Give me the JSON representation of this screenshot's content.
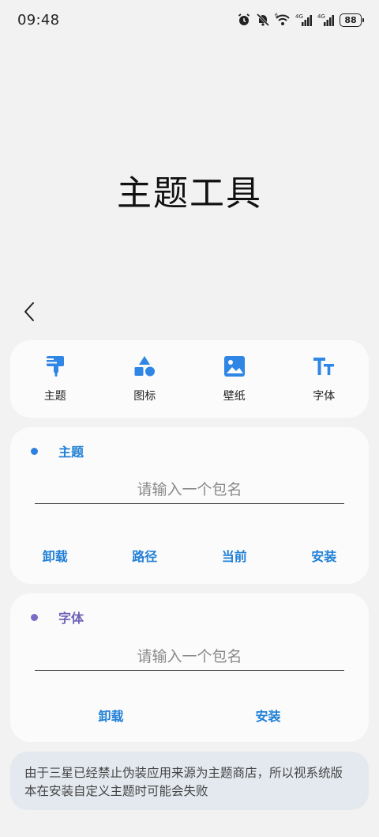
{
  "status_bar": {
    "time": "09:48",
    "icons": [
      "alarm-icon",
      "mute-icon",
      "wifi-icon",
      "signal-4g-icon",
      "signal-4g-icon"
    ],
    "battery": "88"
  },
  "header": {
    "title": "主题工具"
  },
  "tabs": [
    {
      "label": "主题",
      "icon": "brush-icon"
    },
    {
      "label": "图标",
      "icon": "shapes-icon"
    },
    {
      "label": "壁纸",
      "icon": "image-icon"
    },
    {
      "label": "字体",
      "icon": "font-icon"
    }
  ],
  "theme_section": {
    "title": "主题",
    "placeholder": "请输入一个包名",
    "actions": [
      "卸载",
      "路径",
      "当前",
      "安装"
    ],
    "dot_color": "#2f7fe0",
    "title_color": "#1f7fd6"
  },
  "font_section": {
    "title": "字体",
    "placeholder": "请输入一个包名",
    "actions": [
      "卸载",
      "安装"
    ],
    "dot_color": "#7a6cc4",
    "title_color": "#6f63b8"
  },
  "notice": "由于三星已经禁止伪装应用来源为主题商店，所以视系统版本在安装自定义主题时可能会失败",
  "colors": {
    "accent": "#1f7fd6",
    "icon_blue": "#2f86e4"
  }
}
